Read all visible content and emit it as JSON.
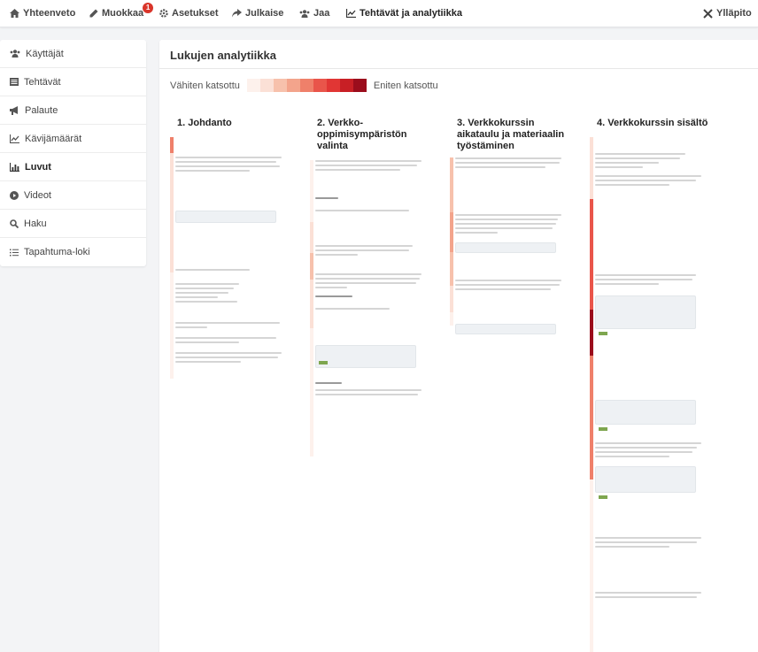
{
  "nav": {
    "items": [
      {
        "label": "Yhteenveto",
        "icon": "home-icon"
      },
      {
        "label": "Muokkaa",
        "icon": "pencil-icon",
        "badge": "1"
      },
      {
        "label": "Asetukset",
        "icon": "gear-icon"
      },
      {
        "label": "Julkaise",
        "icon": "share-icon"
      },
      {
        "label": "Jaa",
        "icon": "users-icon"
      },
      {
        "label": "Tehtävät ja analytiikka",
        "icon": "chart-icon",
        "active": true
      }
    ],
    "admin": {
      "label": "Ylläpito",
      "icon": "tools-icon"
    }
  },
  "sidebar": {
    "items": [
      {
        "label": "Käyttäjät",
        "icon": "users-icon"
      },
      {
        "label": "Tehtävät",
        "icon": "list-icon"
      },
      {
        "label": "Palaute",
        "icon": "megaphone-icon"
      },
      {
        "label": "Kävijämäärät",
        "icon": "line-chart-icon"
      },
      {
        "label": "Luvut",
        "icon": "bar-chart-icon",
        "active": true
      },
      {
        "label": "Videot",
        "icon": "play-icon"
      },
      {
        "label": "Haku",
        "icon": "search-icon"
      },
      {
        "label": "Tapahtuma-loki",
        "icon": "list-ul-icon"
      }
    ]
  },
  "panel": {
    "title": "Lukujen analytiikka",
    "legend": {
      "min_label": "Vähiten katsottu",
      "max_label": "Eniten katsottu",
      "colors": [
        "#fdf1ec",
        "#fbe0d6",
        "#f7c1ac",
        "#f3a48c",
        "#ef806a",
        "#e9554a",
        "#e13634",
        "#c81f25",
        "#9b0d1c"
      ]
    },
    "chapters": [
      {
        "title": "1. Johdanto"
      },
      {
        "title": "2. Verkko-oppimisympäristön valinta"
      },
      {
        "title": "3. Verkkokurssin aikataulu ja materiaalin työstäminen"
      },
      {
        "title": "4. Verkkokurssin sisältö"
      }
    ]
  }
}
